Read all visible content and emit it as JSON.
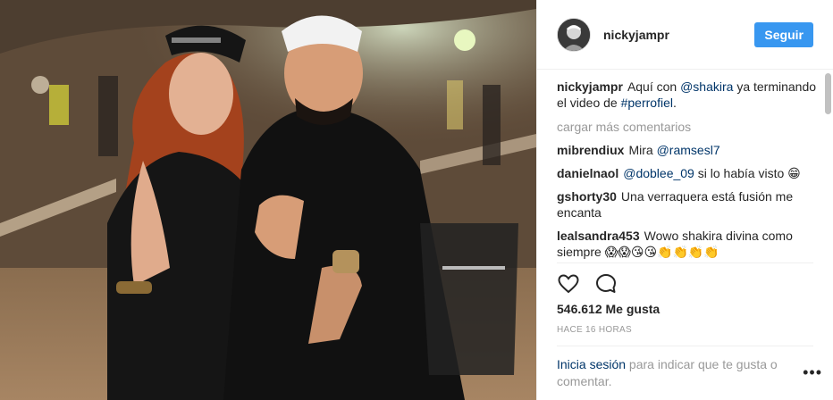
{
  "post": {
    "username": "nickyjampr",
    "follow_label": "Seguir",
    "comments": [
      {
        "user": "nickyjampr",
        "parts": [
          {
            "t": "text",
            "v": "Aquí con "
          },
          {
            "t": "mention",
            "v": "@shakira"
          },
          {
            "t": "text",
            "v": " ya terminando el video de "
          },
          {
            "t": "hashtag",
            "v": "#perrofiel"
          },
          {
            "t": "text",
            "v": "."
          }
        ]
      },
      {
        "user": "mibrendiux",
        "parts": [
          {
            "t": "text",
            "v": "Mira "
          },
          {
            "t": "mention",
            "v": "@ramsesl7"
          }
        ]
      },
      {
        "user": "danielnaol",
        "parts": [
          {
            "t": "mention",
            "v": "@doblee_09"
          },
          {
            "t": "text",
            "v": " si lo había visto 😁"
          }
        ]
      },
      {
        "user": "gshorty30",
        "parts": [
          {
            "t": "text",
            "v": "Una verraquera está fusión me encanta"
          }
        ]
      },
      {
        "user": "lealsandra453",
        "parts": [
          {
            "t": "text",
            "v": "Wowo shakira divina como siempre 😱😱😘😘👏👏👏👏"
          }
        ]
      }
    ],
    "load_more_label": "cargar más comentarios",
    "likes_text": "546.612 Me gusta",
    "time_text": "HACE 16 HORAS",
    "login_link_label": "Inicia sesión",
    "login_rest_text": " para indicar que te gusta o comentar.",
    "more_label": "•••"
  },
  "icons": {
    "like": "heart-outline-icon",
    "comment": "speech-bubble-icon"
  },
  "colors": {
    "follow_button": "#3897f0",
    "link": "#003569",
    "muted": "#999999"
  }
}
